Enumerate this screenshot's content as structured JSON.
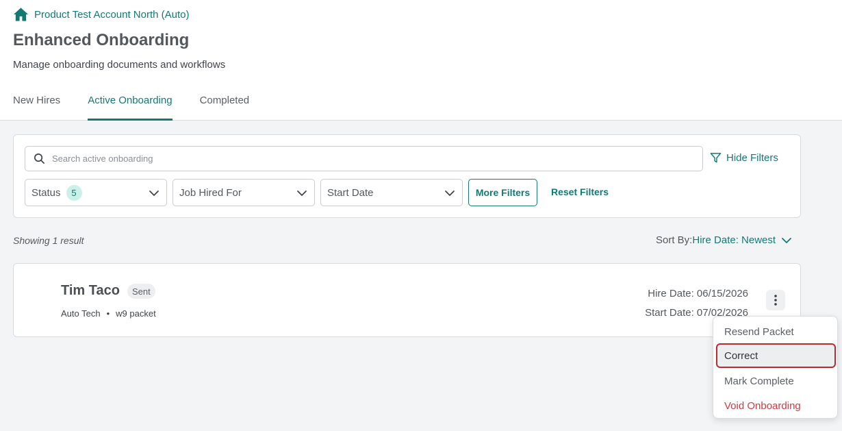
{
  "breadcrumb": {
    "label": "Product Test Account North (Auto)"
  },
  "page": {
    "title": "Enhanced Onboarding",
    "subtitle": "Manage onboarding documents and workflows"
  },
  "tabs": [
    {
      "label": "New Hires",
      "active": false
    },
    {
      "label": "Active Onboarding",
      "active": true
    },
    {
      "label": "Completed",
      "active": false
    }
  ],
  "filters": {
    "search_placeholder": "Search active onboarding",
    "hide_filters_label": "Hide Filters",
    "status_label": "Status",
    "status_count": "5",
    "job_label": "Job Hired For",
    "start_date_label": "Start Date",
    "more_filters_label": "More Filters",
    "reset_filters_label": "Reset Filters"
  },
  "results": {
    "showing": "Showing 1 result",
    "sort_label": "Sort By:",
    "sort_value": "Hire Date: Newest"
  },
  "record": {
    "name": "Tim Taco",
    "status": "Sent",
    "job": "Auto Tech",
    "packet": "w9 packet",
    "hire_date": "Hire Date: 06/15/2026",
    "start_date": "Start Date: 07/02/2026"
  },
  "menu": {
    "items": [
      {
        "label": "Resend Packet"
      },
      {
        "label": "Correct"
      },
      {
        "label": "Mark Complete"
      },
      {
        "label": "Void Onboarding"
      }
    ]
  },
  "colors": {
    "accent": "#127a74",
    "danger": "#cf3a3f",
    "highlight_border": "#c0282e"
  }
}
